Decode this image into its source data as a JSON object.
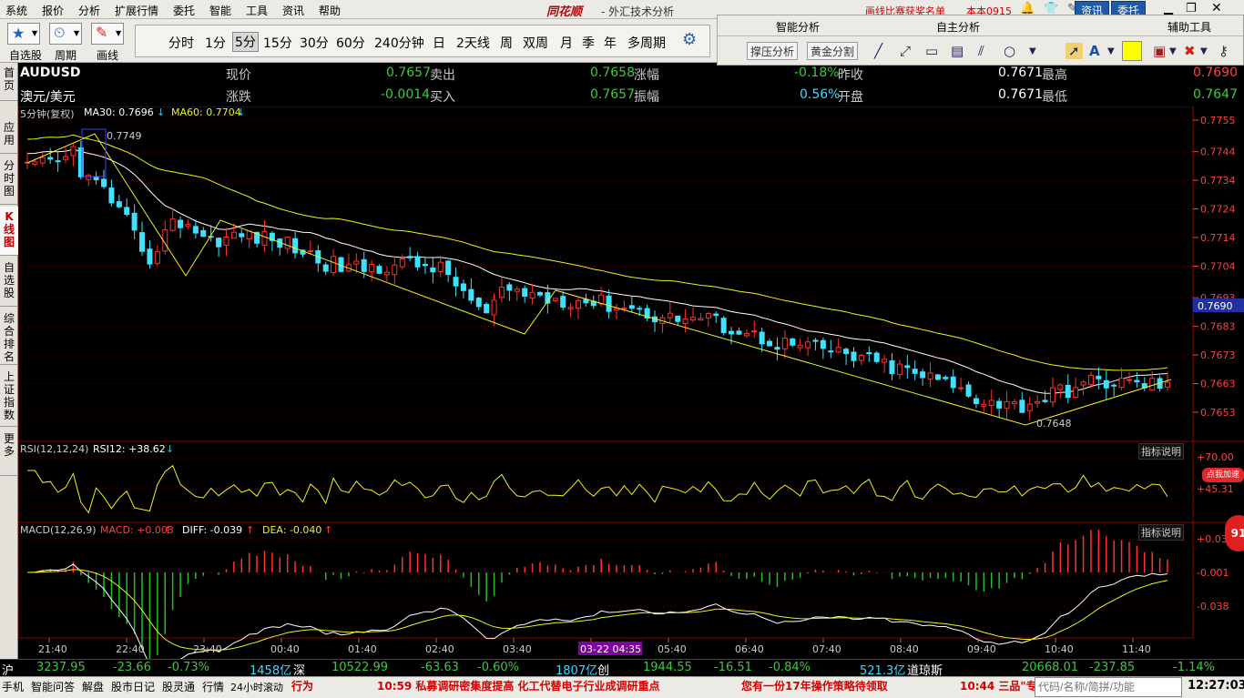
{
  "menu": [
    "系统",
    "报价",
    "分析",
    "扩展行情",
    "委托",
    "智能",
    "工具",
    "资讯",
    "帮助"
  ],
  "app_title": "同花顺",
  "window_subtitle": "- 外汇技术分析",
  "promo_link": "画线比赛获奖名单",
  "version": "本本0915",
  "top_buttons": {
    "news": "资讯",
    "trade": "委托"
  },
  "toolbar": {
    "watchlist": "自选股",
    "period": "周期",
    "draw": "画线"
  },
  "periods": [
    "分时",
    "1分",
    "5分",
    "15分",
    "30分",
    "60分",
    "240分钟",
    "日",
    "2天线",
    "周",
    "双周",
    "月",
    "季",
    "年",
    "多周期"
  ],
  "selected_period": "5分",
  "right_toolbar": {
    "groups": [
      "智能分析",
      "自主分析",
      "辅助工具"
    ],
    "buttons": [
      "撑压分析",
      "黄金分割"
    ]
  },
  "sidebar": [
    "首页",
    "应用",
    "分时图",
    "K线图",
    "自选股",
    "综合排名",
    "上证指数",
    "更多"
  ],
  "quote": {
    "symbol": "AUDUSD",
    "name": "澳元/美元",
    "row1": [
      {
        "label": "现价",
        "value": "0.7657"
      },
      {
        "label": "卖出",
        "value": "0.7658"
      },
      {
        "label": "涨幅",
        "value": "-0.18%"
      },
      {
        "label": "昨收",
        "value": "0.7671"
      },
      {
        "label": "最高",
        "value": "0.7690"
      }
    ],
    "row2": [
      {
        "label": "涨跌",
        "value": "-0.0014"
      },
      {
        "label": "买入",
        "value": "0.7657"
      },
      {
        "label": "振幅",
        "value": "0.56%"
      },
      {
        "label": "开盘",
        "value": "0.7671"
      },
      {
        "label": "最低",
        "value": "0.7647"
      }
    ]
  },
  "main_info": {
    "period": "5分钟(复权)",
    "ma30": "MA30: 0.7696",
    "ma60": "MA60: 0.7704"
  },
  "rsi_info": {
    "label": "RSI(12,12,24)",
    "value": "RSI12: +38.62"
  },
  "macd_info": {
    "label": "MACD(12,26,9)",
    "macd": "MACD: +0.003",
    "diff": "DIFF: -0.039",
    "dea": "DEA: -0.040"
  },
  "indicator_help": "指标说明",
  "add_badge": "点我加速",
  "circle_btn": "91",
  "colors": {
    "up": "#ff3030",
    "down": "#40e0ff",
    "ma30": "#ffffff",
    "ma60": "#f0f020",
    "grid": "#8b0000",
    "axis": "#ff4040"
  },
  "chart_data": {
    "type": "candlestick",
    "price_axis": [
      "0.7755",
      "0.7744",
      "0.7734",
      "0.7724",
      "0.7714",
      "0.7704",
      "0.7693",
      "0.7683",
      "0.7673",
      "0.7663",
      "0.7653"
    ],
    "price_range": [
      0.7648,
      0.7757
    ],
    "current_price_tag": "0.7690",
    "high_annotation": "0.7749",
    "low_annotation": "0.7648",
    "time_axis": [
      "21:40",
      "22:40",
      "23:40",
      "00:40",
      "01:40",
      "02:40",
      "03:40",
      "03-22 04:35",
      "05:40",
      "06:40",
      "07:40",
      "08:40",
      "09:40",
      "10:40",
      "11:40"
    ],
    "rsi_axis": [
      "+70.00",
      "+45.31"
    ],
    "macd_axis": [
      "+0.034",
      "-0.001",
      "-0.038"
    ]
  },
  "status": {
    "sh_label": "沪",
    "sh_index": "3237.95",
    "sh_chg": "-23.66",
    "sh_pct": "-0.73%",
    "sh_vol": "1458亿",
    "sz_label": "深",
    "sz_index": "10522.99",
    "sz_chg": "-63.63",
    "sz_pct": "-0.60%",
    "sz_vol": "1807亿",
    "cy_label": "创",
    "cy_index": "1944.55",
    "cy_chg": "-16.51",
    "cy_pct": "-0.84%",
    "cy_vol": "521.3亿",
    "dj_label": "道琼斯",
    "dj_index": "20668.01",
    "dj_chg": "-237.85",
    "dj_pct": "-1.14%"
  },
  "bottom": {
    "items": [
      "手机",
      "智能问答",
      "解盘",
      "股市日记",
      "股灵通",
      "行情",
      "24小时滚动"
    ],
    "ticker_label": "行为",
    "news1": "10:59 私募调研密集度提高 化工代替电子行业成调研重点",
    "news2": "您有一份17年操作策略待领取",
    "news3": "10:44 三品\"专",
    "code_placeholder": "代码/名称/简拼/功能",
    "clock": "12:27:03"
  }
}
